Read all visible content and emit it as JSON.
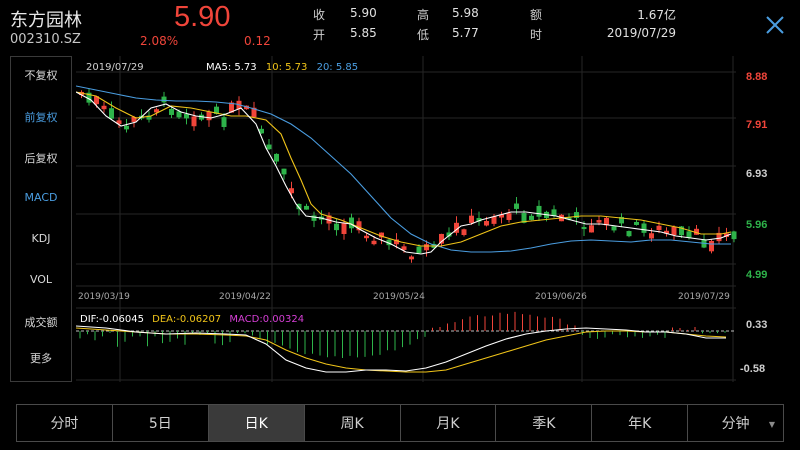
{
  "header": {
    "name": "东方园林",
    "code": "002310.SZ",
    "price": "5.90",
    "change_pct": "2.08%",
    "change": "0.12",
    "stats": [
      {
        "label": "收",
        "value": "5.90"
      },
      {
        "label": "开",
        "value": "5.85"
      },
      {
        "label": "高",
        "value": "5.98"
      },
      {
        "label": "低",
        "value": "5.77"
      },
      {
        "label": "额",
        "value": "1.67亿"
      },
      {
        "label": "时",
        "value": "2019/07/29"
      }
    ]
  },
  "sidebar": {
    "items": [
      {
        "label": "不复权",
        "active": false
      },
      {
        "label": "前复权",
        "active": true
      },
      {
        "label": "后复权",
        "active": false
      },
      {
        "label": "MACD",
        "active": true
      },
      {
        "label": "KDJ",
        "active": false
      },
      {
        "label": "VOL",
        "active": false
      },
      {
        "label": "成交额",
        "active": false
      },
      {
        "label": "更多",
        "active": false
      }
    ]
  },
  "chart": {
    "date_label": "2019/07/29",
    "ma_legend": [
      {
        "label": "MA5:",
        "value": "5.73",
        "color": "#ffffff"
      },
      {
        "label": "10:",
        "value": "5.73",
        "color": "#f0c419"
      },
      {
        "label": "20:",
        "value": "5.85",
        "color": "#4a9de0"
      }
    ],
    "price_ticks": [
      "8.88",
      "7.91",
      "6.93",
      "5.96",
      "4.99"
    ],
    "date_ticks": [
      "2019/03/19",
      "2019/04/22",
      "2019/05/24",
      "2019/06/26",
      "2019/07/29"
    ],
    "macd_legend": [
      {
        "text": "DIF:-0.06045",
        "color": "#ffffff"
      },
      {
        "text": "DEA:-0.06207",
        "color": "#f0c419"
      },
      {
        "text": "MACD:0.00324",
        "color": "#d63fd6"
      }
    ],
    "macd_ticks": [
      "0.33",
      "-0.58"
    ]
  },
  "colors": {
    "up": "#f0453a",
    "down": "#2eb34a",
    "ma5": "#ffffff",
    "ma10": "#f0c419",
    "ma20": "#4a9de0",
    "accent": "#4a9de0"
  },
  "tabs": [
    {
      "label": "分时",
      "active": false
    },
    {
      "label": "5日",
      "active": false
    },
    {
      "label": "日K",
      "active": true
    },
    {
      "label": "周K",
      "active": false
    },
    {
      "label": "月K",
      "active": false
    },
    {
      "label": "季K",
      "active": false
    },
    {
      "label": "年K",
      "active": false
    },
    {
      "label": "分钟",
      "active": false
    }
  ],
  "icons": {
    "close": "close-icon",
    "dropdown": "caret-down-icon"
  }
}
